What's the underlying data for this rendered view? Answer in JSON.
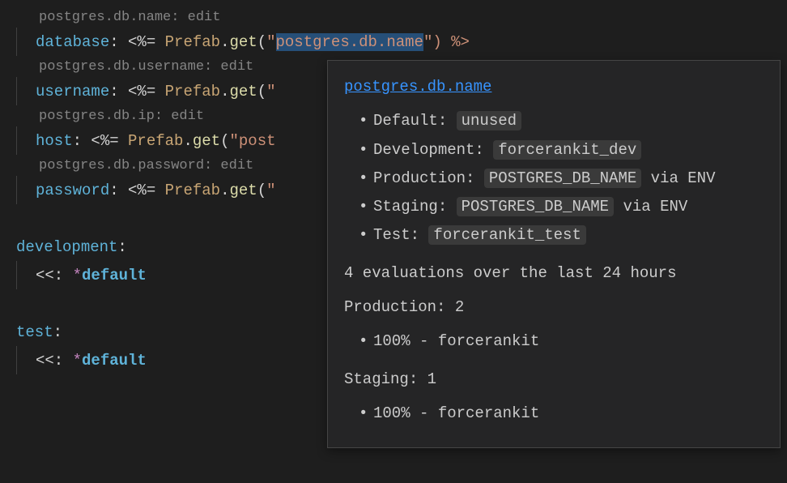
{
  "hints": {
    "db_name": "postgres.db.name: edit",
    "username": "postgres.db.username: edit",
    "ip": "postgres.db.ip: edit",
    "password": "postgres.db.password: edit"
  },
  "code": {
    "database_key": "database",
    "username_key": "username",
    "host_key": "host",
    "password_key": "password",
    "colon_space": ": ",
    "erb_open": "<%= ",
    "class": "Prefab",
    "dot": ".",
    "method": "get",
    "paren_open": "(",
    "str_open": "\"",
    "db_name_arg": "postgres.db.name",
    "str_close_paren_erb": "\") %>",
    "truncated": "\"",
    "host_arg_partial": "post",
    "development": "development",
    "test": "test",
    "section_colon": ":",
    "merge_key": "<<: ",
    "asterisk": "*",
    "default_ref": "default"
  },
  "tooltip": {
    "title": "postgres.db.name",
    "items": [
      {
        "label": "Default: ",
        "value": "unused",
        "suffix": ""
      },
      {
        "label": "Development: ",
        "value": "forcerankit_dev",
        "suffix": ""
      },
      {
        "label": "Production: ",
        "value": "POSTGRES_DB_NAME",
        "suffix": " via ENV"
      },
      {
        "label": "Staging: ",
        "value": "POSTGRES_DB_NAME",
        "suffix": " via ENV"
      },
      {
        "label": "Test: ",
        "value": "forcerankit_test",
        "suffix": ""
      }
    ],
    "summary": "4 evaluations over the last 24 hours",
    "production_header": "Production: 2",
    "production_stat": "100% - forcerankit",
    "staging_header": "Staging: 1",
    "staging_stat": "100% - forcerankit"
  }
}
